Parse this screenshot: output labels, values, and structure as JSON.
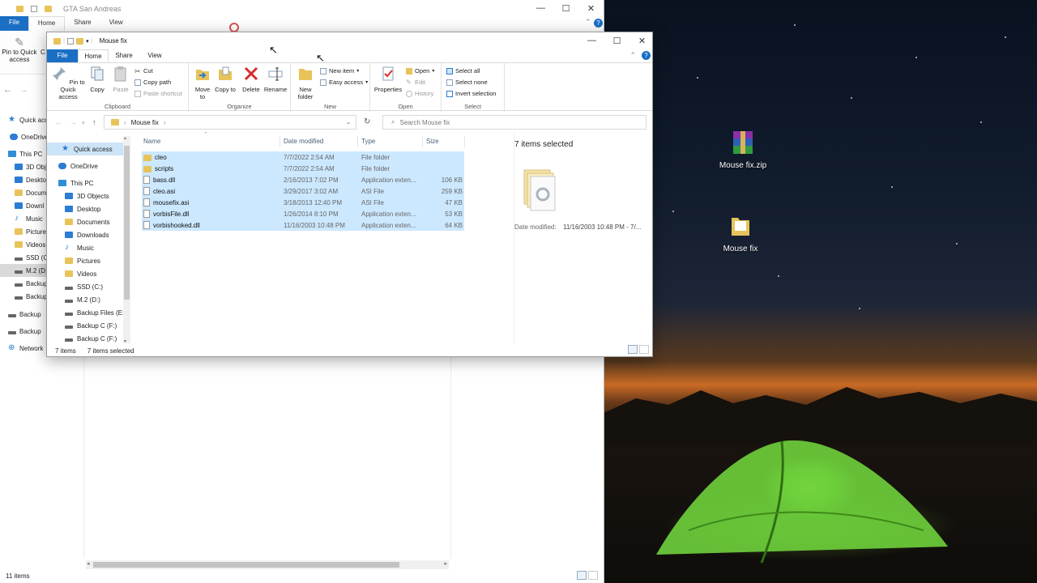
{
  "desktop": {
    "icons": [
      {
        "label": "Mouse fix.zip",
        "icon": "winrar-archive-icon"
      },
      {
        "label": "Mouse fix",
        "icon": "folder-icon"
      }
    ]
  },
  "back_window": {
    "title": "GTA San Andreas",
    "tabs": [
      "File",
      "Home",
      "Share",
      "View"
    ],
    "ribbon_first_button": "Pin to Quick access",
    "ribbon_cut_label": "C",
    "nav_items": [
      {
        "label": "Quick acc",
        "icon": "star"
      },
      {
        "label": "OneDrive",
        "icon": "cloud"
      },
      {
        "label": "This PC",
        "icon": "pc"
      },
      {
        "label": "3D Obje",
        "icon": "blue"
      },
      {
        "label": "Deskto",
        "icon": "blue"
      },
      {
        "label": "Docum",
        "icon": "fold"
      },
      {
        "label": "Downl",
        "icon": "blue"
      },
      {
        "label": "Music",
        "icon": "music"
      },
      {
        "label": "Picture",
        "icon": "fold"
      },
      {
        "label": "Videos",
        "icon": "fold"
      },
      {
        "label": "SSD (C:",
        "icon": "drive"
      },
      {
        "label": "M.2 (D:",
        "icon": "drive"
      },
      {
        "label": "Backup",
        "icon": "drive"
      },
      {
        "label": "Backup",
        "icon": "drive"
      },
      {
        "label": "Backup",
        "icon": "drive"
      },
      {
        "label": "Backup",
        "icon": "drive"
      },
      {
        "label": "Network",
        "icon": "net"
      }
    ],
    "status": "11 items"
  },
  "window": {
    "title": "Mouse fix",
    "tabs": {
      "file": "File",
      "home": "Home",
      "share": "Share",
      "view": "View"
    },
    "ribbon": {
      "clipboard": {
        "label": "Clipboard",
        "pin": "Pin to Quick access",
        "copy": "Copy",
        "paste": "Paste",
        "cut": "Cut",
        "copy_path": "Copy path",
        "paste_shortcut": "Paste shortcut"
      },
      "organize": {
        "label": "Organize",
        "move_to": "Move to",
        "copy_to": "Copy to",
        "delete": "Delete",
        "rename": "Rename"
      },
      "new": {
        "label": "New",
        "new_folder": "New folder",
        "new_item": "New item",
        "easy_access": "Easy access"
      },
      "open": {
        "label": "Open",
        "properties": "Properties",
        "open": "Open",
        "edit": "Edit",
        "history": "History"
      },
      "select": {
        "label": "Select",
        "select_all": "Select all",
        "select_none": "Select none",
        "invert": "Invert selection"
      }
    },
    "address": {
      "path": "Mouse fix",
      "search_placeholder": "Search Mouse fix"
    },
    "nav": [
      {
        "label": "Quick access",
        "icon": "star",
        "selected": true
      },
      {
        "label": "OneDrive",
        "icon": "cloud"
      },
      {
        "label": "This PC",
        "icon": "pc"
      },
      {
        "label": "3D Objects",
        "icon": "blue"
      },
      {
        "label": "Desktop",
        "icon": "blue"
      },
      {
        "label": "Documents",
        "icon": "fold"
      },
      {
        "label": "Downloads",
        "icon": "blue"
      },
      {
        "label": "Music",
        "icon": "music"
      },
      {
        "label": "Pictures",
        "icon": "fold"
      },
      {
        "label": "Videos",
        "icon": "fold"
      },
      {
        "label": "SSD (C:)",
        "icon": "drive"
      },
      {
        "label": "M.2 (D:)",
        "icon": "drive"
      },
      {
        "label": "Backup Files (E:)",
        "icon": "drive"
      },
      {
        "label": "Backup C (F:)",
        "icon": "drive"
      },
      {
        "label": "Backup C (F:)",
        "icon": "drive"
      }
    ],
    "columns": {
      "name": "Name",
      "date": "Date modified",
      "type": "Type",
      "size": "Size"
    },
    "files": [
      {
        "name": "cleo",
        "date": "7/7/2022 2:54 AM",
        "type": "File folder",
        "size": "",
        "kind": "folder"
      },
      {
        "name": "scripts",
        "date": "7/7/2022 2:54 AM",
        "type": "File folder",
        "size": "",
        "kind": "folder"
      },
      {
        "name": "bass.dll",
        "date": "2/16/2013 7:02 PM",
        "type": "Application exten...",
        "size": "106 KB",
        "kind": "file"
      },
      {
        "name": "cleo.asi",
        "date": "3/29/2017 3:02 AM",
        "type": "ASI File",
        "size": "259 KB",
        "kind": "file"
      },
      {
        "name": "mousefix.asi",
        "date": "3/18/2013 12:40 PM",
        "type": "ASI File",
        "size": "47 KB",
        "kind": "file"
      },
      {
        "name": "vorbisFile.dll",
        "date": "1/26/2014 8:10 PM",
        "type": "Application exten...",
        "size": "53 KB",
        "kind": "file"
      },
      {
        "name": "vorbishooked.dll",
        "date": "11/16/2003 10:48 PM",
        "type": "Application exten...",
        "size": "64 KB",
        "kind": "file"
      }
    ],
    "details": {
      "count": "7 items selected",
      "date_label": "Date modified:",
      "date_value": "11/16/2003 10:48 PM - 7/..."
    },
    "status": {
      "items": "7 items",
      "selected": "7 items selected"
    }
  },
  "colors": {
    "accent": "#1a6fc4",
    "selection": "#cce8ff",
    "folder": "#e8c35a"
  }
}
